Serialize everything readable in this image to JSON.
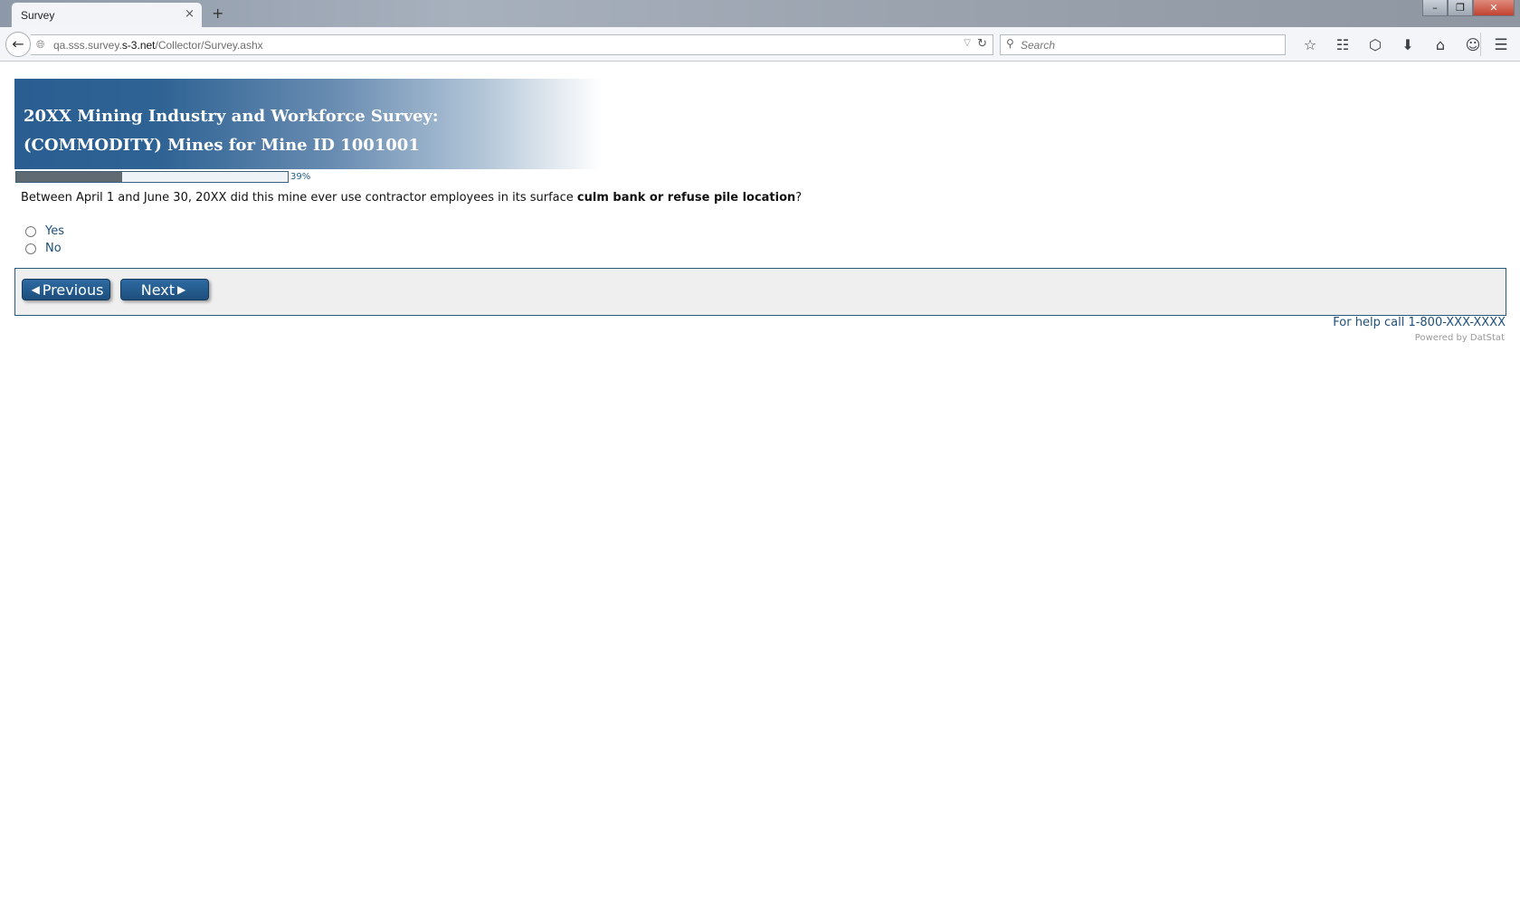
{
  "browser": {
    "tab_title": "Survey",
    "tab_close": "×",
    "new_tab": "+",
    "url_prefix": "qa.sss.survey.",
    "url_domain": "s-3.net",
    "url_path": "/Collector/Survey.ashx",
    "search_placeholder": "Search",
    "window_controls": {
      "minimize": "–",
      "restore": "❐",
      "close": "✕"
    },
    "icons": [
      "star-icon",
      "reading-list-icon",
      "pocket-icon",
      "download-icon",
      "home-icon",
      "chat-icon",
      "menu-icon"
    ]
  },
  "survey": {
    "title_line1": "20XX Mining Industry and Workforce Survey:",
    "title_line2": "(COMMODITY) Mines for Mine ID 1001001",
    "progress_percent": 39,
    "progress_label": "39%",
    "question_prefix": "Between April 1 and June 30, 20XX did this mine ever use contractor employees in its surface ",
    "question_emphasis": "culm bank or refuse pile location",
    "question_suffix": "?",
    "options": [
      {
        "label": "Yes",
        "selected": false
      },
      {
        "label": "No",
        "selected": false
      }
    ],
    "previous_label": "Previous",
    "next_label": "Next",
    "help_text": "For help call 1-800-XXX-XXXX",
    "powered_by": "Powered by DatStat"
  },
  "colors": {
    "banner_blue": "#2a5d91",
    "button_blue": "#1d4f7e",
    "link_blue": "#1e4f7a",
    "progress_fill": "#5f6a72"
  }
}
